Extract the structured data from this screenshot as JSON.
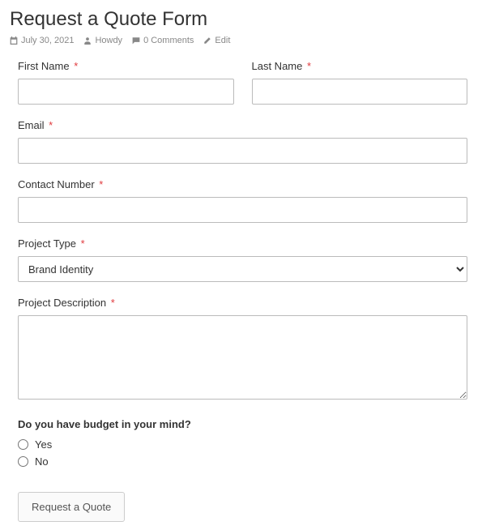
{
  "header": {
    "title": "Request a Quote Form",
    "meta": {
      "date": "July 30, 2021",
      "author": "Howdy",
      "comments": "0 Comments",
      "edit": "Edit"
    }
  },
  "form": {
    "first_name": {
      "label": "First Name",
      "value": ""
    },
    "last_name": {
      "label": "Last Name",
      "value": ""
    },
    "email": {
      "label": "Email",
      "value": ""
    },
    "contact_number": {
      "label": "Contact Number",
      "value": ""
    },
    "project_type": {
      "label": "Project Type",
      "selected": "Brand Identity"
    },
    "project_description": {
      "label": "Project Description",
      "value": ""
    },
    "budget_question": {
      "label": "Do you have budget in your mind?",
      "options": [
        "Yes",
        "No"
      ]
    },
    "submit_label": "Request a Quote",
    "required_mark": "*"
  }
}
